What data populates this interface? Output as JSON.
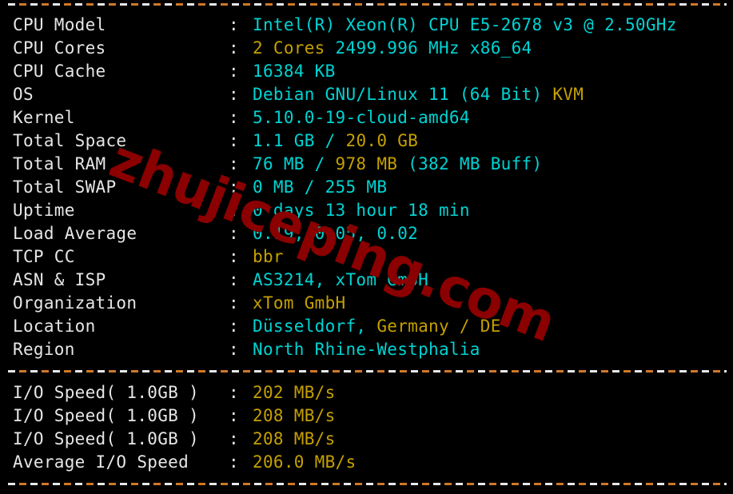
{
  "terminal": {
    "background": "#000000",
    "label_color": "#e6e6e6",
    "value_color": "#00d3d3",
    "highlight_color": "#c5a000",
    "rule_colors": [
      "#e8e8e8",
      "#d07828"
    ],
    "separator": "----------------------------------------------------------------------",
    "colon": ":"
  },
  "watermark": {
    "text": "zhujiceping.com",
    "color": "#8b0000"
  },
  "system": {
    "rows": [
      {
        "label": "CPU Model",
        "segments": [
          {
            "text": "Intel(R) Xeon(R) CPU E5-2678 v3 @ 2.50GHz",
            "highlight": false
          }
        ]
      },
      {
        "label": "CPU Cores",
        "segments": [
          {
            "text": "2 Cores",
            "highlight": true
          },
          {
            "text": " 2499.996 MHz x86_64",
            "highlight": false
          }
        ]
      },
      {
        "label": "CPU Cache",
        "segments": [
          {
            "text": "16384 KB",
            "highlight": false
          }
        ]
      },
      {
        "label": "OS",
        "segments": [
          {
            "text": "Debian GNU/Linux 11 (64 Bit) ",
            "highlight": false
          },
          {
            "text": "KVM",
            "highlight": true
          }
        ]
      },
      {
        "label": "Kernel",
        "segments": [
          {
            "text": "5.10.0-19-cloud-amd64",
            "highlight": false
          }
        ]
      },
      {
        "label": "Total Space",
        "segments": [
          {
            "text": "1.1 GB / ",
            "highlight": false
          },
          {
            "text": "20.0 GB",
            "highlight": true
          }
        ]
      },
      {
        "label": "Total RAM",
        "segments": [
          {
            "text": "76 MB / ",
            "highlight": false
          },
          {
            "text": "978 MB",
            "highlight": true
          },
          {
            "text": " (382 MB Buff)",
            "highlight": false
          }
        ]
      },
      {
        "label": "Total SWAP",
        "segments": [
          {
            "text": "0 MB / 255 MB",
            "highlight": false
          }
        ]
      },
      {
        "label": "Uptime",
        "segments": [
          {
            "text": "0 days 13 hour 18 min",
            "highlight": false
          }
        ]
      },
      {
        "label": "Load Average",
        "segments": [
          {
            "text": "0.19, 0.05, 0.02",
            "highlight": false
          }
        ]
      },
      {
        "label": "TCP CC",
        "segments": [
          {
            "text": "bbr",
            "highlight": true
          }
        ]
      },
      {
        "label": "ASN & ISP",
        "segments": [
          {
            "text": "AS3214, xTom GmbH",
            "highlight": false
          }
        ]
      },
      {
        "label": "Organization",
        "segments": [
          {
            "text": "xTom GmbH",
            "highlight": true
          }
        ]
      },
      {
        "label": "Location",
        "segments": [
          {
            "text": "Düsseldorf, ",
            "highlight": false
          },
          {
            "text": "Germany / DE",
            "highlight": true
          }
        ]
      },
      {
        "label": "Region",
        "segments": [
          {
            "text": "North Rhine-Westphalia",
            "highlight": false
          }
        ]
      }
    ]
  },
  "io": {
    "rows": [
      {
        "label": "I/O Speed( 1.0GB )",
        "segments": [
          {
            "text": "202 MB/s",
            "highlight": true
          }
        ]
      },
      {
        "label": "I/O Speed( 1.0GB )",
        "segments": [
          {
            "text": "208 MB/s",
            "highlight": true
          }
        ]
      },
      {
        "label": "I/O Speed( 1.0GB )",
        "segments": [
          {
            "text": "208 MB/s",
            "highlight": true
          }
        ]
      },
      {
        "label": "Average I/O Speed",
        "segments": [
          {
            "text": "206.0 MB/s",
            "highlight": true
          }
        ]
      }
    ]
  }
}
